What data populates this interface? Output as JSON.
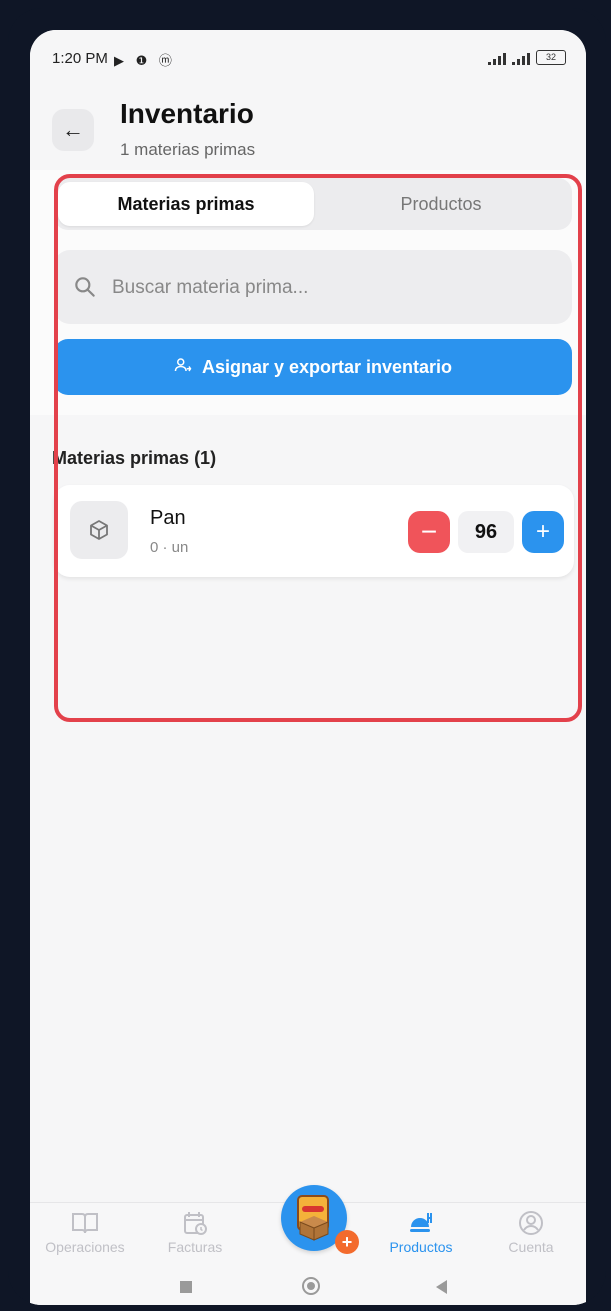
{
  "status_bar": {
    "time": "1:20 PM",
    "icons": "▶ ❶ ⓜ",
    "battery": "32"
  },
  "header": {
    "title": "Inventario",
    "subtitle": "1 materias primas",
    "back_icon": "arrow-left-icon"
  },
  "tabs": [
    {
      "label": "Materias primas",
      "active": true
    },
    {
      "label": "Productos",
      "active": false
    }
  ],
  "search": {
    "placeholder": "Buscar materia prima...",
    "value": ""
  },
  "assign_button": {
    "label": "Asignar y exportar inventario",
    "icon": "user-assign-icon"
  },
  "section": {
    "title": "Materias primas (1)"
  },
  "items": [
    {
      "name": "Pan",
      "meta": "0 · un",
      "quantity": "96",
      "icon": "box-icon"
    }
  ],
  "bottom_nav": [
    {
      "label": "Operaciones",
      "icon": "book-icon",
      "active": false
    },
    {
      "label": "Facturas",
      "icon": "calendar-clock-icon",
      "active": false
    },
    {
      "label": "Productos",
      "icon": "food-tray-icon",
      "active": true
    },
    {
      "label": "Cuenta",
      "icon": "user-circle-icon",
      "active": false
    }
  ],
  "colors": {
    "accent": "#2b93ee",
    "danger": "#f0545a",
    "highlight": "#e3414b"
  }
}
